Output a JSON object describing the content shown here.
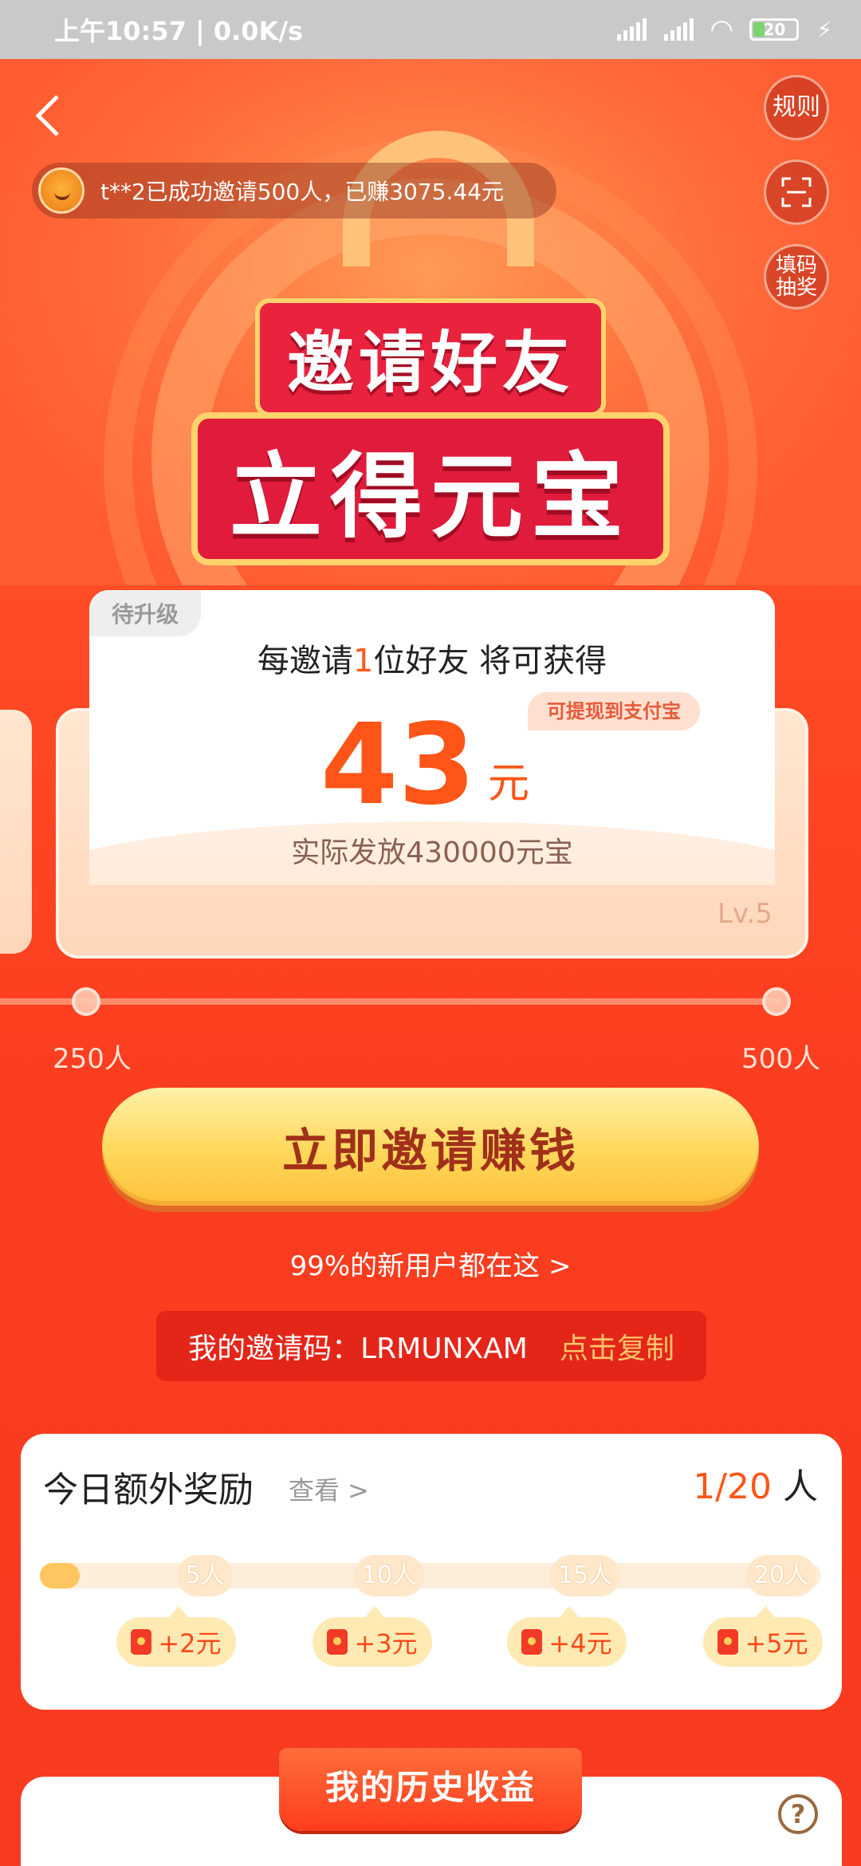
{
  "status_bar": {
    "time": "上午10:57 | 0.0K/s",
    "battery": "20"
  },
  "header": {
    "back_icon": "chevron-left-icon",
    "rules_label": "规则",
    "scan_icon": "scan-icon",
    "lottery_label": "填码\n抽奖",
    "ticker_text": "t**2已成功邀请500人，已赚3075.44元",
    "title_line1": "邀请好友",
    "title_line2": "立得元宝"
  },
  "reward_card": {
    "pending_tag": "待升级",
    "line_prefix": "每邀请",
    "line_count": "1",
    "line_suffix": "位好友 将可获得",
    "withdraw_badge": "可提现到支付宝",
    "amount": "43",
    "amount_unit": "元",
    "actual_text": "实际发放430000元宝",
    "level": "Lv.5"
  },
  "progress": {
    "left_label": "250人",
    "right_label": "500人"
  },
  "cta": {
    "invite_button": "立即邀请赚钱",
    "new_users_link": "99%的新用户都在这 >",
    "invite_code_label": "我的邀请码：LRMUNXAM",
    "copy_label": "点击复制"
  },
  "bonus": {
    "title": "今日额外奖励",
    "view_link": "查看 >",
    "count_current": "1/20",
    "count_unit": " 人",
    "progress_fraction": 0.05,
    "milestones": [
      {
        "label": "5人",
        "reward": "+2元"
      },
      {
        "label": "10人",
        "reward": "+3元"
      },
      {
        "label": "15人",
        "reward": "+4元"
      },
      {
        "label": "20人",
        "reward": "+5元"
      }
    ]
  },
  "history": {
    "title": "我的历史收益",
    "help_icon": "question-circle-icon"
  },
  "colors": {
    "accent": "#ff5518",
    "cta_text": "#a0301a",
    "copy_link": "#ffc36a"
  }
}
